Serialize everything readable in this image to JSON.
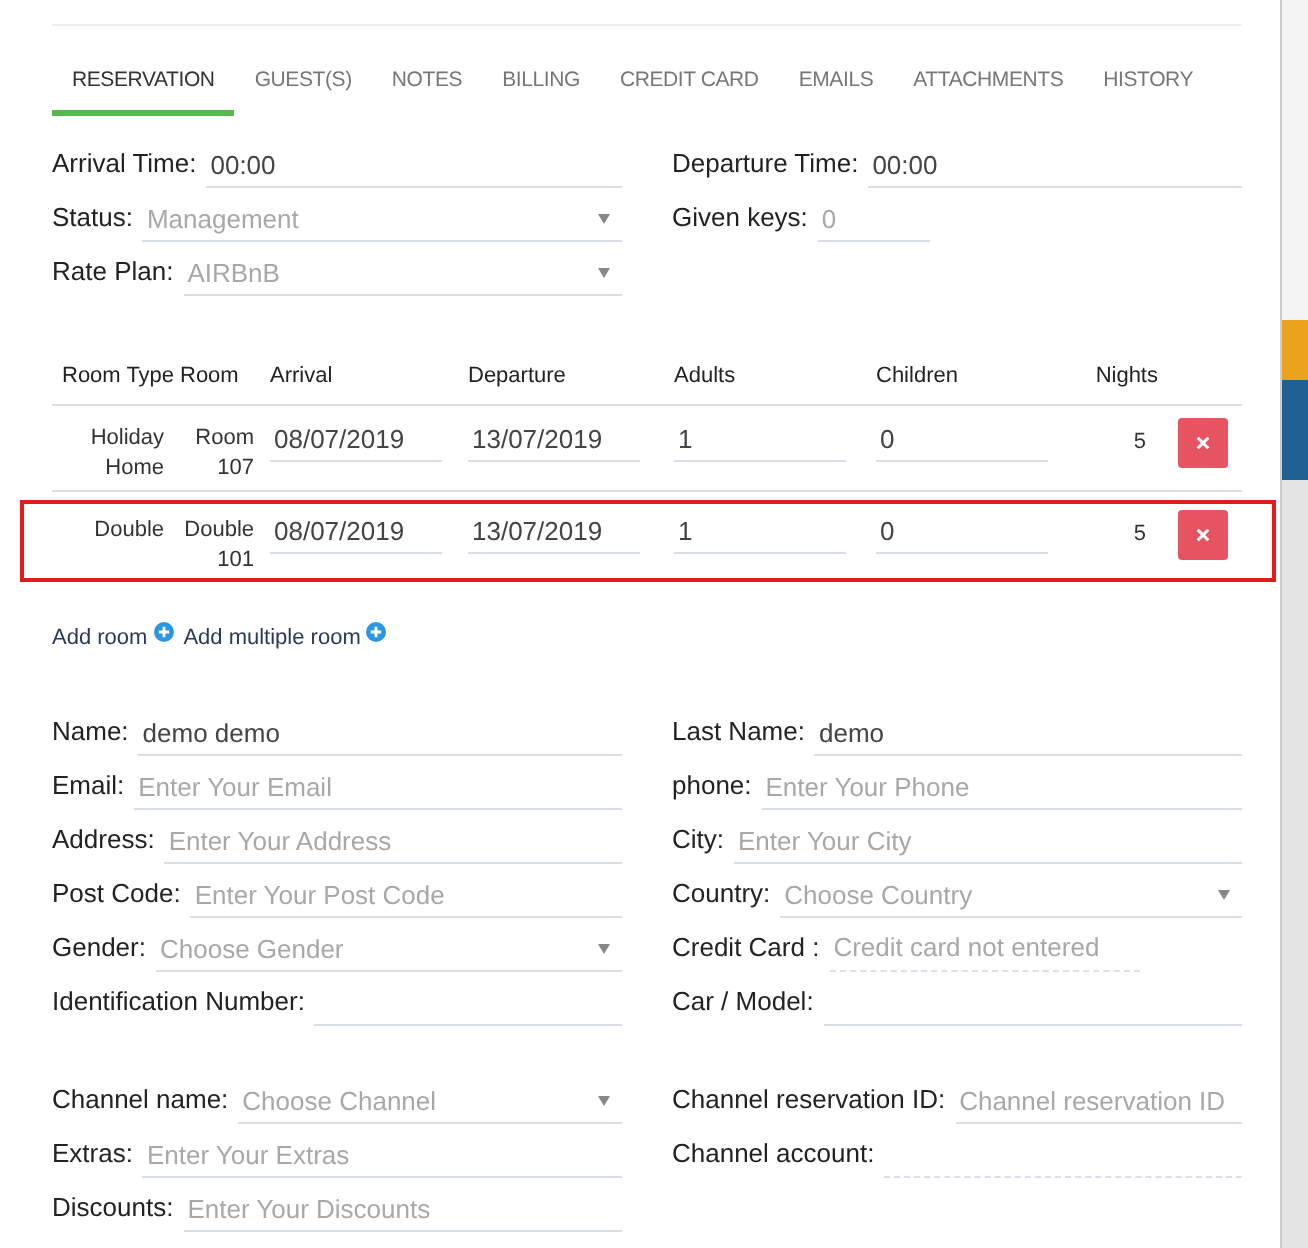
{
  "tabs": [
    {
      "label": "RESERVATION",
      "selected": true
    },
    {
      "label": "GUEST(S)",
      "selected": false
    },
    {
      "label": "NOTES",
      "selected": false
    },
    {
      "label": "BILLING",
      "selected": false
    },
    {
      "label": "CREDIT CARD",
      "selected": false
    },
    {
      "label": "EMAILS",
      "selected": false
    },
    {
      "label": "ATTACHMENTS",
      "selected": false
    },
    {
      "label": "HISTORY",
      "selected": false
    }
  ],
  "booking_fields": [
    {
      "label": "Arrival Time:",
      "kind": "text",
      "value": "00:00"
    },
    {
      "label": "Departure Time:",
      "kind": "text",
      "value": "00:00"
    },
    {
      "label": "Status:",
      "kind": "select",
      "placeholder": "Management"
    },
    {
      "label": "Given keys:",
      "kind": "short",
      "placeholder": "0"
    },
    {
      "label": "Rate Plan:",
      "kind": "select",
      "placeholder": "AIRBnB"
    }
  ],
  "rooms": {
    "columns": [
      "Room Type",
      "Room",
      "Arrival",
      "Departure",
      "Adults",
      "Children",
      "Nights"
    ],
    "rows": [
      {
        "room_type": "Holiday Home",
        "room": "Room 107",
        "arrival": "08/07/2019",
        "departure": "13/07/2019",
        "adults": "1",
        "children": "0",
        "nights": "5",
        "selected": false
      },
      {
        "room_type": "Double",
        "room": "Double 101",
        "arrival": "08/07/2019",
        "departure": "13/07/2019",
        "adults": "1",
        "children": "0",
        "nights": "5",
        "selected": true
      }
    ],
    "links": [
      "Add room",
      "Add multiple room"
    ]
  },
  "guest_fields": [
    {
      "label": "Name:",
      "kind": "text",
      "value": "demo demo"
    },
    {
      "label": "Last Name:",
      "kind": "text",
      "value": "demo"
    },
    {
      "label": "Email:",
      "kind": "text",
      "placeholder": "Enter Your Email"
    },
    {
      "label": "phone:",
      "kind": "text",
      "placeholder": "Enter Your Phone"
    },
    {
      "label": "Address:",
      "kind": "text",
      "placeholder": "Enter Your Address"
    },
    {
      "label": "City:",
      "kind": "text",
      "placeholder": "Enter Your City"
    },
    {
      "label": "Post Code:",
      "kind": "text",
      "placeholder": "Enter Your Post Code"
    },
    {
      "label": "Country:",
      "kind": "select",
      "placeholder": "Choose Country"
    },
    {
      "label": "Gender:",
      "kind": "select",
      "placeholder": "Choose Gender"
    },
    {
      "label": "Credit Card :",
      "kind": "static",
      "placeholder": "Credit card not entered"
    },
    {
      "label": "Identification Number:",
      "kind": "text"
    },
    {
      "label": "Car / Model:",
      "kind": "text"
    }
  ],
  "channel_fields": [
    {
      "label": "Channel name:",
      "kind": "select",
      "placeholder": "Choose Channel"
    },
    {
      "label": "Channel reservation ID:",
      "kind": "text",
      "placeholder": "Channel reservation ID"
    },
    {
      "label": "Extras:",
      "kind": "text",
      "placeholder": "Enter Your Extras"
    },
    {
      "label": "Channel account:",
      "kind": "static"
    },
    {
      "label": "Discounts:",
      "kind": "text",
      "placeholder": "Enter Your Discounts"
    }
  ]
}
